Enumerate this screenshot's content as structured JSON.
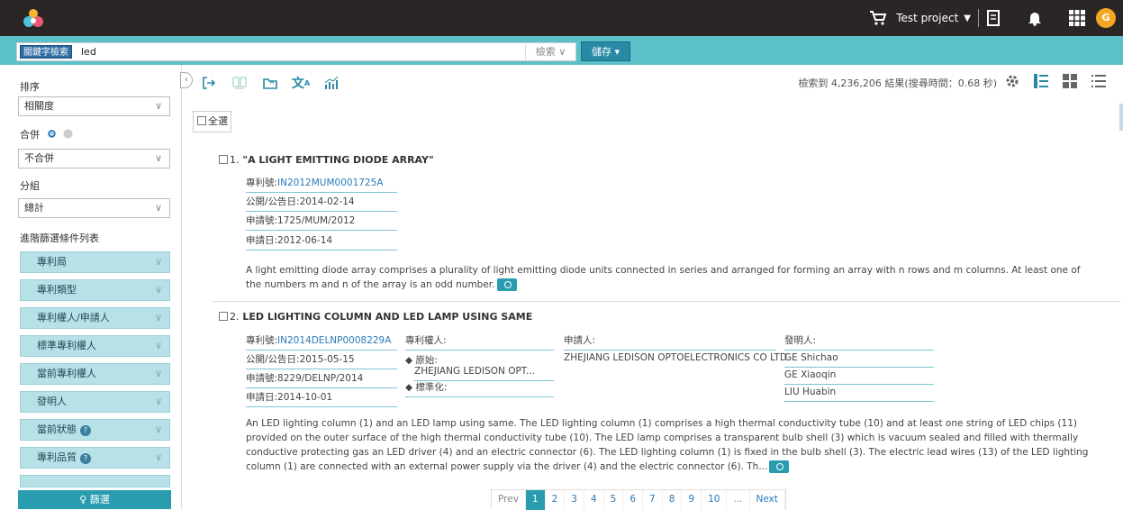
{
  "header": {
    "project": "Test project",
    "avatar_letter": "G"
  },
  "search": {
    "keyword_tag": "關鍵字檢索",
    "query": "led",
    "search_label": "檢索 ∨",
    "save_label": "儲存 ▾"
  },
  "sidebar": {
    "sort_label": "排序",
    "sort_value": "相關度",
    "merge_label": "合併",
    "merge_value": "不合併",
    "group_label": "分組",
    "group_value": "總計",
    "advanced_label": "進階篩選條件列表",
    "filters": [
      {
        "label": "專利局"
      },
      {
        "label": "專利類型"
      },
      {
        "label": "專利權人/申請人"
      },
      {
        "label": "標準專利權人"
      },
      {
        "label": "當前專利權人"
      },
      {
        "label": "發明人"
      },
      {
        "label": "當前狀態"
      },
      {
        "label": "專利品質"
      }
    ],
    "filter_button": "♀ 篩選"
  },
  "results_info": "檢索到 4,236,206 結果(搜尋時間：0.68 秒)",
  "select_all": "全選",
  "results": [
    {
      "num": "1.",
      "title": "\"A LIGHT EMITTING DIODE ARRAY\"",
      "patent_no_label": "專利號:",
      "patent_no": "IN2012MUM0001725A",
      "pub_date": "公開/公告日:2014-02-14",
      "app_no": "申請號:1725/MUM/2012",
      "app_date": "申請日:2012-06-14",
      "abstract": "A light emitting diode array comprises a plurality of light emitting diode units connected in series and arranged for forming an array with n rows and m columns. At least one of the numbers m and n of the array is an odd number."
    },
    {
      "num": "2.",
      "title": "LED LIGHTING COLUMN AND LED LAMP USING SAME",
      "patent_no_label": "專利號:",
      "patent_no": "IN2014DELNP0008229A",
      "pub_date": "公開/公告日:2015-05-15",
      "app_no": "申請號:8229/DELNP/2014",
      "app_date": "申請日:2014-10-01",
      "assignee_label": "專利權人:",
      "original_label": "◆ 原始:",
      "original_value": "ZHEJIANG LEDISON OPT...",
      "standard_label": "◆ 標準化:",
      "applicant_label": "申請人:",
      "applicant_value": "ZHEJIANG LEDISON OPTOELECTRONICS CO LTD.",
      "inventor_label": "發明人:",
      "inventors": [
        "GE Shichao",
        "GE Xiaoqin",
        "LIU Huabin"
      ],
      "abstract": "An LED lighting column (1) and an LED lamp using same. The LED lighting column (1) comprises a high thermal conductivity tube (10) and at least one string of LED chips (11) provided on the outer surface of the high thermal conductivity tube (10). The LED lamp comprises a transparent bulb shell (3) which is vacuum sealed and filled with thermally conductive protecting gas an LED driver (4) and an electric connector (6). The LED lighting column (1) is fixed in the bulb shell (3). The electric lead wires (13) of the LED lighting column (1) are connected with an external power supply via the driver (4) and the electric connector (6). Th..."
    }
  ],
  "pagination": {
    "prev": "Prev",
    "pages": [
      "1",
      "2",
      "3",
      "4",
      "5",
      "6",
      "7",
      "8",
      "9",
      "10"
    ],
    "ellipsis": "...",
    "next": "Next"
  }
}
